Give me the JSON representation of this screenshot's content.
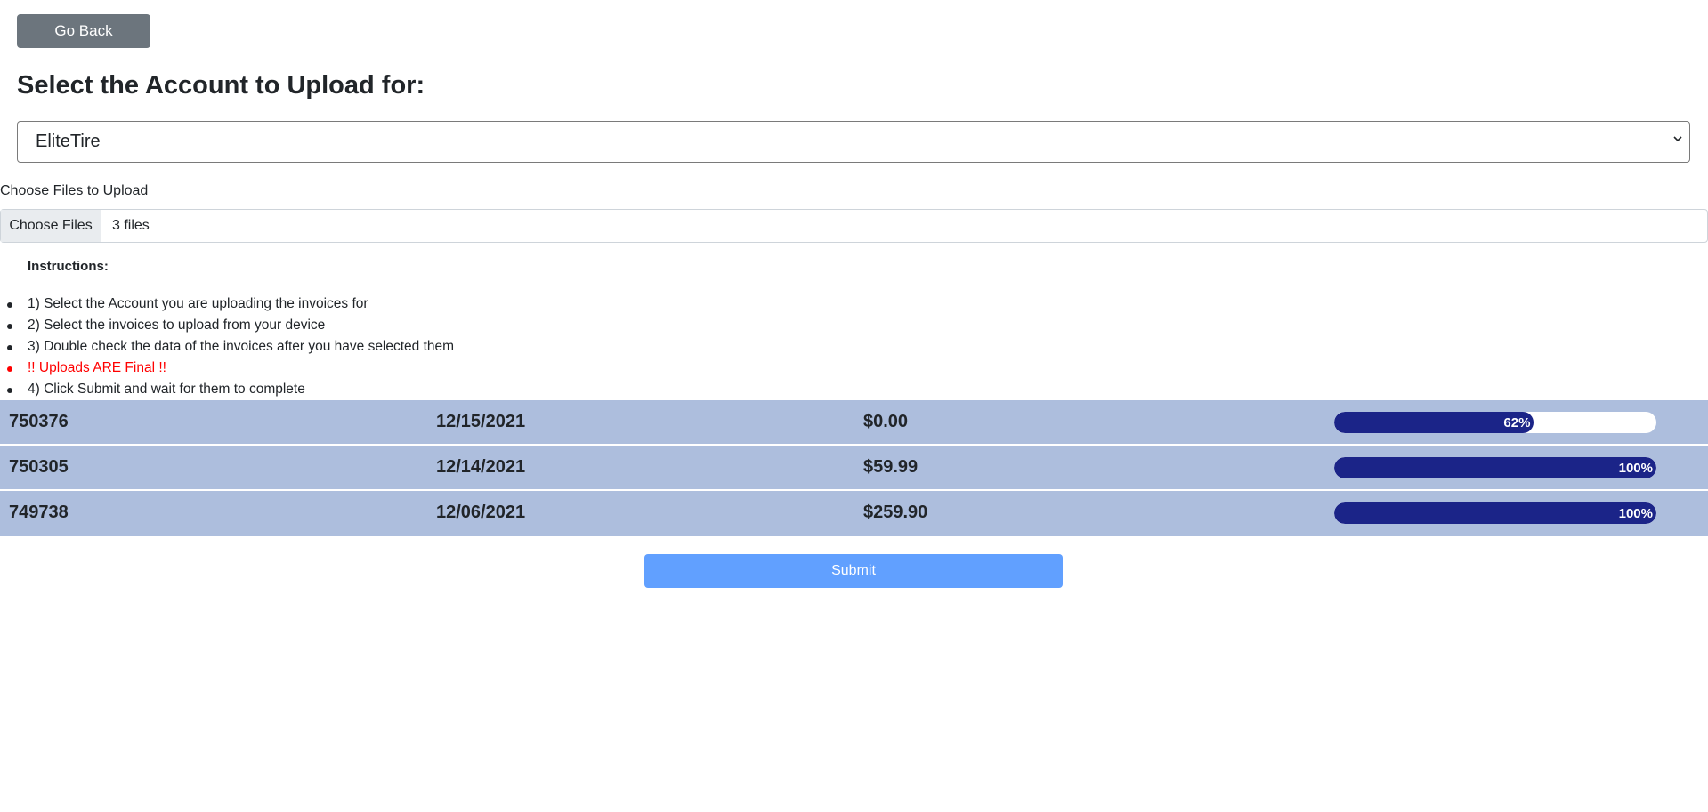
{
  "nav": {
    "back_label": "Go Back"
  },
  "heading": "Select the Account to Upload for:",
  "account_select": {
    "selected": "EliteTire"
  },
  "file_upload": {
    "label": "Choose Files to Upload",
    "button_label": "Choose Files",
    "status": "3 files"
  },
  "instructions": {
    "title": "Instructions:",
    "steps": [
      "1) Select the Account you are uploading the invoices for",
      "2) Select the invoices to upload from your device",
      "3) Double check the data of the invoices after you have selected them",
      "!! Uploads ARE Final !!",
      "4) Click Submit and wait for them to complete"
    ]
  },
  "invoices": [
    {
      "number": "750376",
      "date": "12/15/2021",
      "amount": "$0.00",
      "progress_percent": 62,
      "progress_label": "62%"
    },
    {
      "number": "750305",
      "date": "12/14/2021",
      "amount": "$59.99",
      "progress_percent": 100,
      "progress_label": "100%"
    },
    {
      "number": "749738",
      "date": "12/06/2021",
      "amount": "$259.90",
      "progress_percent": 100,
      "progress_label": "100%"
    }
  ],
  "submit_label": "Submit",
  "colors": {
    "row_bg": "#adbedd",
    "progress_fill": "#1b2488",
    "submit_bg": "#61a0ff",
    "warning_text": "#ff0000",
    "back_button_bg": "#6c757d"
  },
  "icons": {
    "select_caret": "chevron-down-icon"
  }
}
